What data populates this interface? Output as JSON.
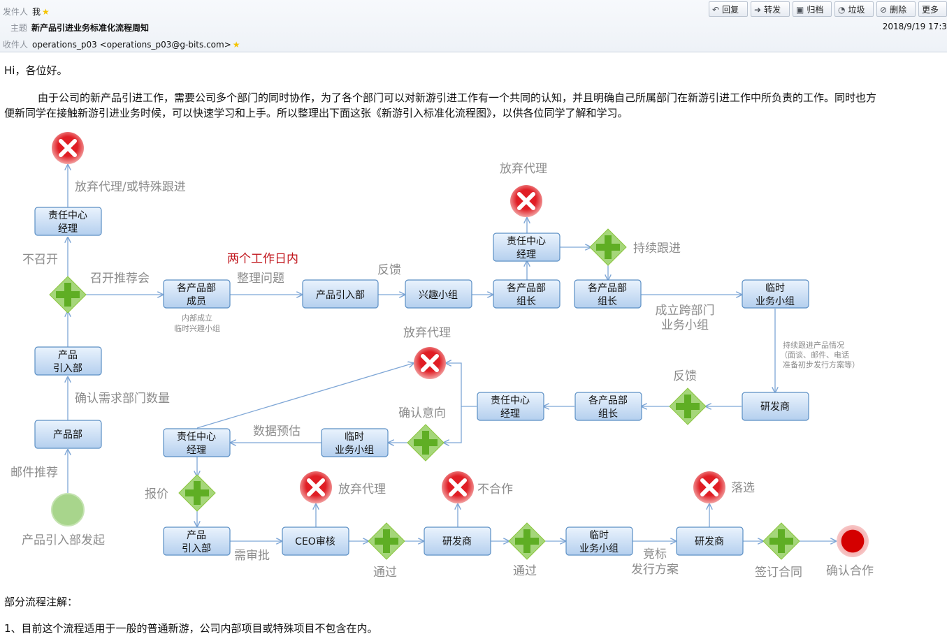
{
  "header": {
    "from_key": "发件人",
    "from_value": "我",
    "subject_key": "主题",
    "subject_value": "新产品引进业务标准化流程周知",
    "to_key": "收件人",
    "to_value": "operations_p03 <operations_p03@g-bits.com>",
    "date": "2018/9/19 17:3"
  },
  "toolbar": {
    "reply": "回复",
    "forward": "转发",
    "archive": "归档",
    "junk": "垃圾",
    "delete": "删除",
    "more": "更多"
  },
  "body": {
    "greeting": "Hi，各位好。",
    "para1_line1": "由于公司的新产品引进工作，需要公司多个部门的同时协作，为了各个部门可以对新游引进工作有一个共同的认知，并且明确自己所属部门在新游引进工作中所负责的工作。同时也方",
    "para1_line2": "便新同学在接触新游引进业务时候，可以快速学习和上手。所以整理出下面这张《新游引入标准化流程图》，以供各位同学了解和学习。",
    "notes_title": "部分流程注解：",
    "note1": "1、目前这个流程适用于一般的普通新游，公司内部项目或特殊项目不包含在内。"
  },
  "diagram": {
    "boxes": {
      "b1": [
        "责任中心",
        "经理"
      ],
      "b2": [
        "产品",
        "引入部"
      ],
      "b3": [
        "产品部"
      ],
      "b4": [
        "各产品部",
        "成员"
      ],
      "b5": [
        "产品引入部"
      ],
      "b6": [
        "兴趣小组"
      ],
      "b7": [
        "各产品部",
        "组长"
      ],
      "b8": [
        "责任中心",
        "经理"
      ],
      "b9": [
        "各产品部",
        "组长"
      ],
      "b10": [
        "临时",
        "业务小组"
      ],
      "b11": [
        "研发商"
      ],
      "b12": [
        "各产品部",
        "组长"
      ],
      "b13": [
        "责任中心",
        "经理"
      ],
      "b14": [
        "临时",
        "业务小组"
      ],
      "b15": [
        "责任中心",
        "经理"
      ],
      "b16": [
        "产品",
        "引入部"
      ],
      "b17": [
        "CEO审核"
      ],
      "b18": [
        "研发商"
      ],
      "b19": [
        "临时",
        "业务小组"
      ],
      "b20": [
        "研发商"
      ]
    },
    "labels": {
      "l_giveup_special": "放弃代理/或特殊跟进",
      "l_not_hold": "不召开",
      "l_hold_meeting": "召开推荐会",
      "l_two_days": "两个工作日内",
      "l_organize": "整理问题",
      "l_feedback1": "反馈",
      "l_giveup_top": "放弃代理",
      "l_continue": "持续跟进",
      "l_internal1": "内部成立",
      "l_internal2": "临时兴趣小组",
      "l_cross1": "成立跨部门",
      "l_cross2": "业务小组",
      "l_giveup_mid": "放弃代理",
      "l_track1": "持续跟进产品情况",
      "l_track2": "（面谈、邮件、电话",
      "l_track3": "准备初步发行方案等）",
      "l_confirm_count": "确认需求部门数量",
      "l_feedback2": "反馈",
      "l_confirm_intent": "确认意向",
      "l_data_est": "数据预估",
      "l_email_rec": "邮件推荐",
      "l_quote": "报价",
      "l_giveup_low": "放弃代理",
      "l_no_coop": "不合作",
      "l_eliminated": "落选",
      "l_start": "产品引入部发起",
      "l_need_approval": "需审批",
      "l_pass1": "通过",
      "l_pass2": "通过",
      "l_bid1": "竞标",
      "l_bid2": "发行方案",
      "l_sign": "签订合同",
      "l_confirm_coop": "确认合作"
    }
  },
  "colors": {
    "box_top": "#eaf3fd",
    "box_bottom": "#b4cfee",
    "box_border": "#5b8fc4",
    "arrow": "#7ea6d6",
    "gateway": "#8cc63f",
    "reject": "#e01e25",
    "label": "#8c8c8c",
    "label_red": "#c0141b"
  },
  "icons": {
    "reply": "reply-arrow-icon",
    "forward": "forward-arrow-icon",
    "archive": "archive-box-icon",
    "junk": "junk-icon",
    "delete": "delete-prohibit-icon",
    "star": "star-icon",
    "gateway": "green-plus-diamond-icon",
    "reject": "red-x-circle-icon"
  }
}
